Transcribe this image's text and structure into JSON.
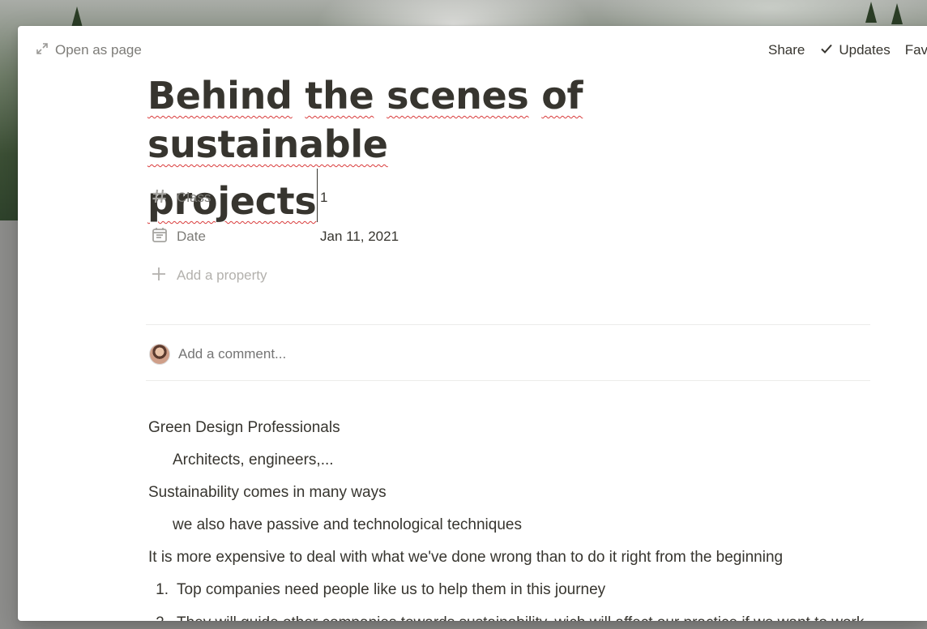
{
  "topbar": {
    "open_as_page": "Open as page",
    "share": "Share",
    "updates": "Updates",
    "favorite": "Fav"
  },
  "title": {
    "line1_words": [
      "Behind",
      "the",
      "scenes",
      "of",
      "sustainable"
    ],
    "line2_word": "projects"
  },
  "properties": [
    {
      "icon": "hash-icon",
      "label": "Class",
      "value": "1"
    },
    {
      "icon": "calendar-icon",
      "label": "Date",
      "value": "Jan 11, 2021"
    }
  ],
  "add_property": "Add a property",
  "comment": {
    "placeholder": "Add a comment..."
  },
  "blocks": {
    "b1": "Green Design Professionals",
    "b2": "Architects, engineers,...",
    "b3": "Sustainability comes in many ways",
    "b4": "we also have passive and technological techniques",
    "b5": "It is more expensive to deal with what we've done wrong than to do it right from the beginning",
    "list": [
      {
        "num": "1.",
        "text": "Top companies need people like us to help them in this journey"
      },
      {
        "num": "2.",
        "text": "They will guide other companies towards sustainability, wich will affect our practice if we want to work with big companies"
      }
    ]
  },
  "colors": {
    "text": "#37352f",
    "muted": "#7d7c78",
    "placeholder": "#b3b1ad",
    "spellcheck": "#d93b3b"
  }
}
